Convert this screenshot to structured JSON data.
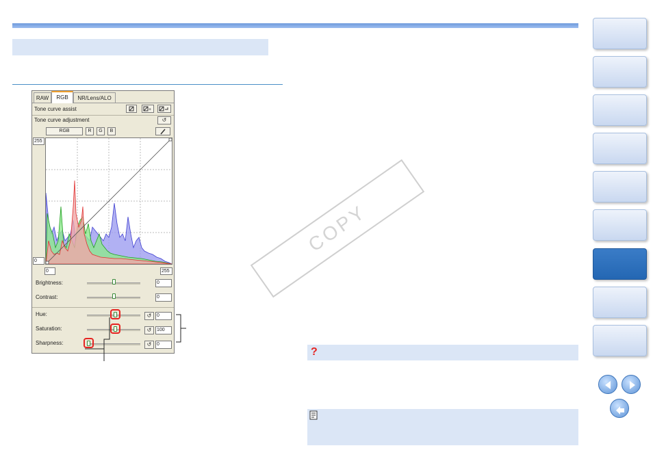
{
  "panel": {
    "tabs": [
      "RAW",
      "RGB",
      "NR/Lens/ALO"
    ],
    "active_tab": "RGB",
    "tone_curve_assist_label": "Tone curve assist",
    "tone_curve_adjustment_label": "Tone curve adjustment",
    "channel_buttons": [
      "RGB",
      "R",
      "G",
      "B"
    ],
    "graph": {
      "y_max_label": "255",
      "y_min_label": "0",
      "x_min_value": "0",
      "x_max_value": "255"
    },
    "brightness": {
      "label": "Brightness:",
      "value": "0"
    },
    "contrast": {
      "label": "Contrast:",
      "value": "0"
    },
    "hue": {
      "label": "Hue:",
      "value": "0"
    },
    "saturation": {
      "label": "Saturation:",
      "value": "100"
    },
    "sharpness": {
      "label": "Sharpness:",
      "value": "0"
    }
  },
  "watermark": "COPY",
  "colors": {
    "accent": "#2467b3",
    "highlight": "#e52421",
    "section_bg": "#dbe6f6"
  },
  "icons": {
    "question": "?",
    "reset": "↺"
  }
}
